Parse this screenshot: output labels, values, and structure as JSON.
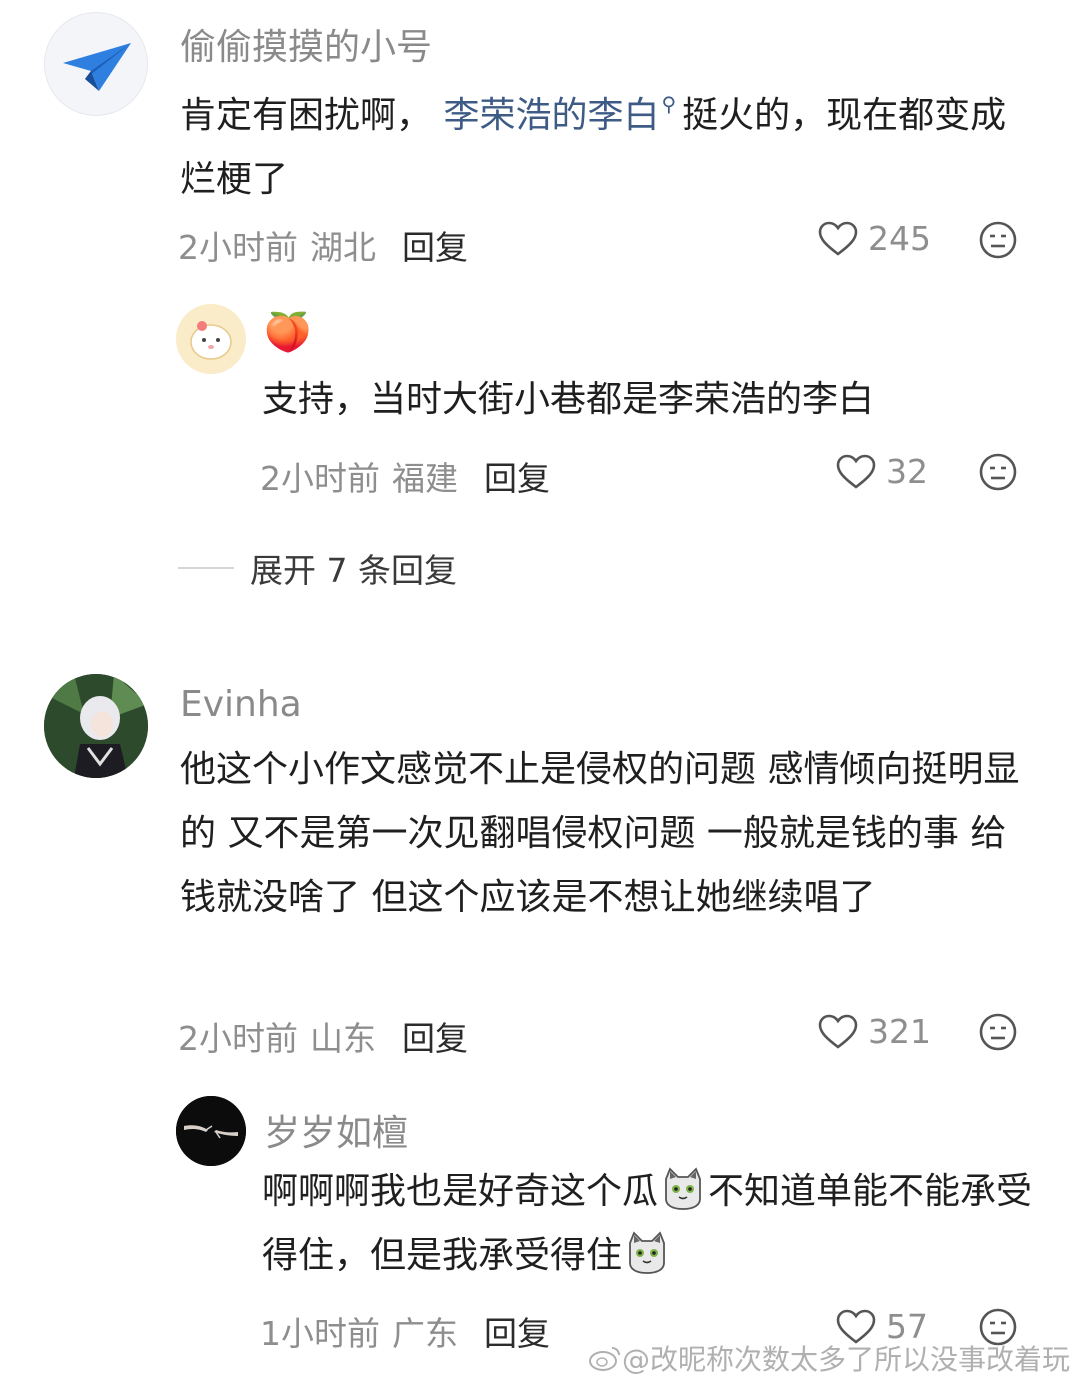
{
  "comments": [
    {
      "username": "偷偷摸摸的小号",
      "content_before": "肯定有困扰啊，",
      "mention": "李荣浩的李白",
      "content_after": "挺火的，现在都变成烂梗了",
      "time": "2小时前",
      "location": "湖北",
      "reply_label": "回复",
      "likes": "245",
      "avatar_icon": "paper-plane-icon",
      "replies": [
        {
          "username": "🍑",
          "content": "支持，当时大街小巷都是李荣浩的李白",
          "time": "2小时前",
          "location": "福建",
          "reply_label": "回复",
          "likes": "32",
          "avatar_icon": "cartoon-pet-icon"
        }
      ],
      "expand_label": "展开 7 条回复"
    },
    {
      "username": "Evinha",
      "content": "他这个小作文感觉不止是侵权的问题 感情倾向挺明显的 又不是第一次见翻唱侵权问题 一般就是钱的事 给钱就没啥了 但这个应该是不想让她继续唱了",
      "time": "2小时前",
      "location": "山东",
      "reply_label": "回复",
      "likes": "321",
      "avatar_icon": "anime-character-icon",
      "replies": [
        {
          "username": "岁岁如檀",
          "content_part1": "啊啊啊我也是好奇这个瓜",
          "content_part2": "不知道单能不能承受得住，但是我承受得住",
          "time": "1小时前",
          "location": "广东",
          "reply_label": "回复",
          "likes": "57",
          "avatar_icon": "hands-icon",
          "emoji_icon": "cat-emoji-icon"
        }
      ]
    }
  ],
  "watermark": "@改昵称次数太多了所以没事改着玩",
  "colors": {
    "mention": "#3e5b86",
    "meta": "#8e8e8e",
    "text": "#1f1f1f"
  }
}
